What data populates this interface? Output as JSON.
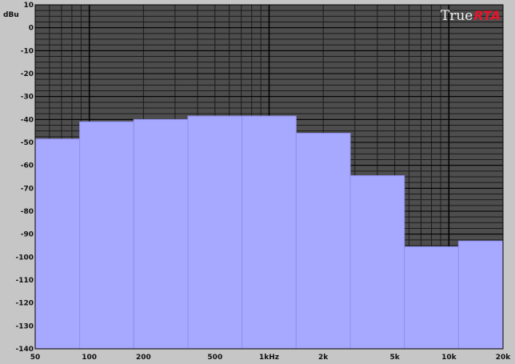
{
  "unit_label": "dBu",
  "brand": {
    "part1": "True",
    "part2": "RTA"
  },
  "colors": {
    "panel": "#c6c6c6",
    "plot_background": "#4d4d4d",
    "minor_grid": "#1b1b1b",
    "major_grid": "#000000",
    "bar_fill": "#a7a8ff",
    "bar_edge": "#8f90ea",
    "brand_true": "#f2f2f2",
    "brand_rta": "#e8142c"
  },
  "chart_data": {
    "type": "bar",
    "xscale": "log",
    "xlim": [
      50,
      20000
    ],
    "ylim": [
      -140,
      10
    ],
    "ylabel": "dBu",
    "grid": true,
    "x_ticks": [
      {
        "value": 50,
        "label": "50"
      },
      {
        "value": 100,
        "label": "100"
      },
      {
        "value": 200,
        "label": "200"
      },
      {
        "value": 500,
        "label": "500"
      },
      {
        "value": 1000,
        "label": "1kHz"
      },
      {
        "value": 2000,
        "label": "2k"
      },
      {
        "value": 5000,
        "label": "5k"
      },
      {
        "value": 10000,
        "label": "10k"
      },
      {
        "value": 20000,
        "label": "20k"
      }
    ],
    "y_ticks": [
      10,
      0,
      -10,
      -20,
      -30,
      -40,
      -50,
      -60,
      -70,
      -80,
      -90,
      -100,
      -110,
      -120,
      -130,
      -140
    ],
    "bands": [
      {
        "center": 63,
        "value": -48.5
      },
      {
        "center": 125,
        "value": -41
      },
      {
        "center": 250,
        "value": -40
      },
      {
        "center": 500,
        "value": -38.5
      },
      {
        "center": 1000,
        "value": -38.5
      },
      {
        "center": 2000,
        "value": -46
      },
      {
        "center": 4000,
        "value": -64.5
      },
      {
        "center": 8000,
        "value": -95.5
      },
      {
        "center": 16000,
        "value": -93
      }
    ]
  }
}
